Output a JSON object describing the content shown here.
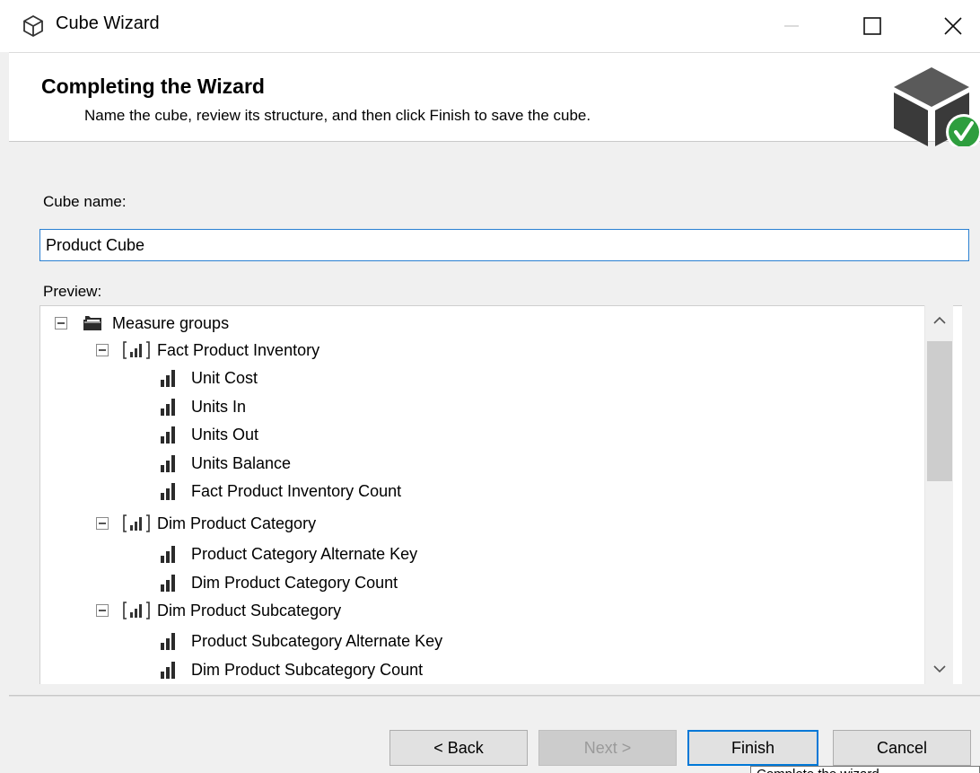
{
  "window": {
    "title": "Cube Wizard",
    "icon": "cube-outline-icon"
  },
  "header": {
    "title": "Completing the Wizard",
    "subtitle": "Name the cube, review its structure, and then click Finish to save the cube.",
    "graphic": "cube-checkmark-icon"
  },
  "form": {
    "cube_name_label": "Cube name:",
    "cube_name_value": "Product Cube",
    "preview_label": "Preview:"
  },
  "tree": {
    "root": "Measure groups",
    "groups": [
      {
        "name": "Fact Product Inventory",
        "measures": [
          "Unit Cost",
          "Units In",
          "Units Out",
          "Units Balance",
          "Fact Product Inventory Count"
        ]
      },
      {
        "name": "Dim Product Category",
        "measures": [
          "Product Category Alternate Key",
          "Dim Product Category Count"
        ]
      },
      {
        "name": "Dim Product Subcategory",
        "measures": [
          "Product Subcategory Alternate Key",
          "Dim Product Subcategory Count"
        ]
      }
    ]
  },
  "buttons": {
    "back": "< Back",
    "next": "Next >",
    "finish": "Finish",
    "cancel": "Cancel"
  },
  "tooltip": "Complete the wizard",
  "colors": {
    "accent": "#0078d7",
    "check_green": "#2e9e3e",
    "cube_dark": "#3a3a3a"
  }
}
